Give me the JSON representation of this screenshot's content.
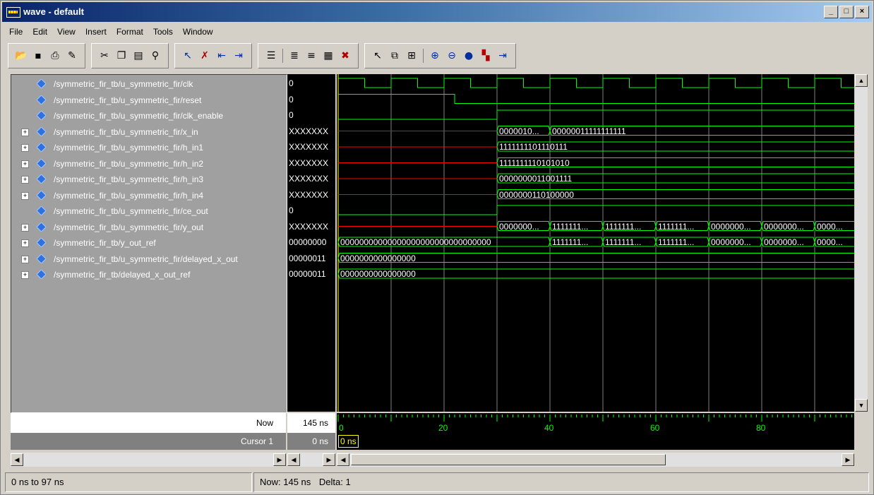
{
  "window": {
    "title": "wave - default"
  },
  "menu": [
    "File",
    "Edit",
    "View",
    "Insert",
    "Format",
    "Tools",
    "Window"
  ],
  "toolbar_groups": [
    [
      "open-icon",
      "save-icon",
      "print-icon",
      "properties-icon"
    ],
    [
      "cut-icon",
      "copy-icon",
      "paste-icon",
      "find-icon"
    ],
    [
      "insert-cursor-icon",
      "delete-cursor-icon",
      "previous-edge-icon",
      "next-edge-icon"
    ],
    [
      "format-icon",
      "sort-up-icon",
      "sort-down-icon",
      "list-icon",
      "delete-all-icon"
    ],
    [
      "select-mode-icon",
      "zoom-mode-icon",
      "split-icon",
      "zoom-in-icon",
      "zoom-out-icon",
      "zoom-full-icon",
      "marker-icon",
      "cursor-goto-icon"
    ]
  ],
  "signals": [
    {
      "name": "/symmetric_fir_tb/u_symmetric_fir/clk",
      "value": "0",
      "expandable": false
    },
    {
      "name": "/symmetric_fir_tb/u_symmetric_fir/reset",
      "value": "0",
      "expandable": false
    },
    {
      "name": "/symmetric_fir_tb/u_symmetric_fir/clk_enable",
      "value": "0",
      "expandable": false
    },
    {
      "name": "/symmetric_fir_tb/u_symmetric_fir/x_in",
      "value": "XXXXXXX",
      "expandable": true
    },
    {
      "name": "/symmetric_fir_tb/u_symmetric_fir/h_in1",
      "value": "XXXXXXX",
      "expandable": true
    },
    {
      "name": "/symmetric_fir_tb/u_symmetric_fir/h_in2",
      "value": "XXXXXXX",
      "expandable": true
    },
    {
      "name": "/symmetric_fir_tb/u_symmetric_fir/h_in3",
      "value": "XXXXXXX",
      "expandable": true
    },
    {
      "name": "/symmetric_fir_tb/u_symmetric_fir/h_in4",
      "value": "XXXXXXX",
      "expandable": true
    },
    {
      "name": "/symmetric_fir_tb/u_symmetric_fir/ce_out",
      "value": "0",
      "expandable": false
    },
    {
      "name": "/symmetric_fir_tb/u_symmetric_fir/y_out",
      "value": "XXXXXXX",
      "expandable": true
    },
    {
      "name": "/symmetric_fir_tb/y_out_ref",
      "value": "00000000",
      "expandable": true
    },
    {
      "name": "/symmetric_fir_tb/u_symmetric_fir/delayed_x_out",
      "value": "00000011",
      "expandable": true
    },
    {
      "name": "/symmetric_fir_tb/delayed_x_out_ref",
      "value": "00000011",
      "expandable": true
    }
  ],
  "wave_labels": {
    "x_in_1": "0000010...",
    "x_in_2": "00000011111111111",
    "h_in1": "1111111101110111",
    "h_in2": "1111111110101010",
    "h_in3": "0000000011001111",
    "h_in4": "0000000110100000",
    "y_out": [
      "0000000...",
      "1111111...",
      "1111111...",
      "1111111...",
      "0000000...",
      "0000000...",
      "0000..."
    ],
    "y_out_ref": [
      "00000000000000000000000000000000",
      "1111111...",
      "1111111...",
      "1111111...",
      "0000000...",
      "0000000...",
      "0000..."
    ],
    "delayed_x_out": "0000000000000000",
    "delayed_x_out_ref": "0000000000000000"
  },
  "bottom": {
    "now_label": "Now",
    "now_value": "145 ns",
    "cursor_label": "Cursor 1",
    "cursor_value": "0 ns",
    "cursor_tag": "0 ns",
    "ticks": [
      "0",
      "20",
      "40",
      "60",
      "80"
    ]
  },
  "status": {
    "range": "0 ns to 97 ns",
    "now": "Now: 145 ns",
    "delta": "Delta: 1"
  },
  "colors": {
    "wave": "#00ff00",
    "undefined": "#ff0000",
    "grid": "#808080",
    "cursor": "#ffff00",
    "background": "#000000"
  }
}
